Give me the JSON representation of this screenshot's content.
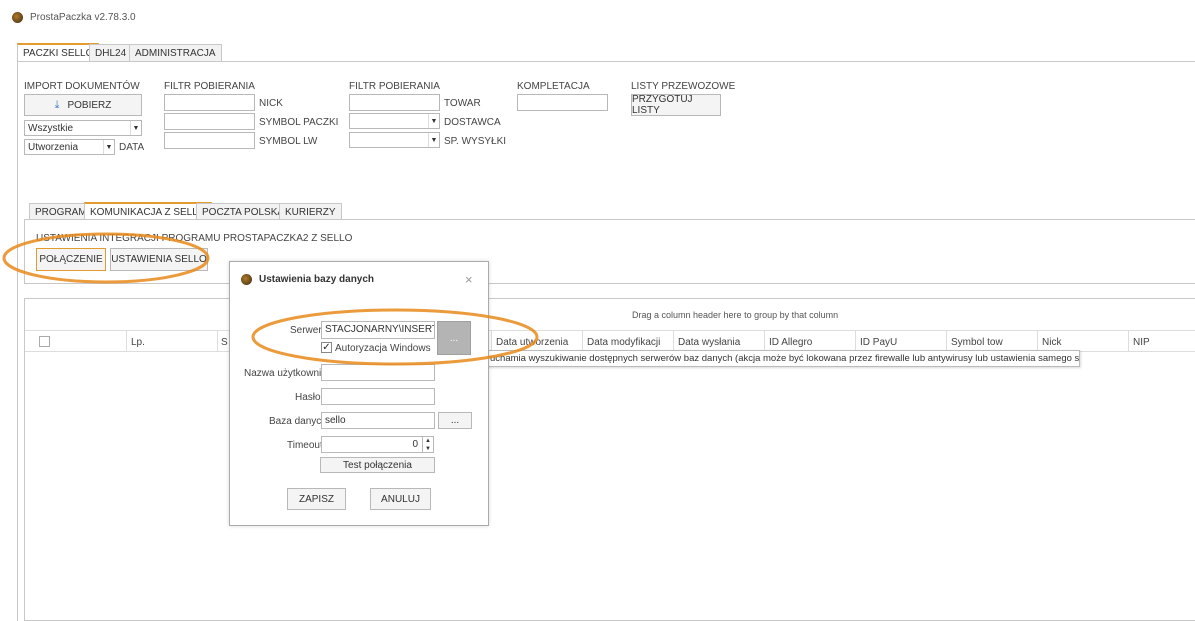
{
  "window": {
    "title": "ProstaPaczka v2.78.3.0"
  },
  "main_tabs": [
    "PACZKI SELLO",
    "DHL24",
    "ADMINISTRACJA"
  ],
  "import": {
    "heading": "IMPORT DOKUMENTÓW",
    "fetch_label": "POBIERZ",
    "filter_select": "Wszystkie",
    "date_select": "Utworzenia",
    "date_label": "DATA"
  },
  "filter1": {
    "heading": "FILTR POBIERANIA",
    "nick": "NICK",
    "symbol_paczki": "SYMBOL PACZKI",
    "symbol_lw": "SYMBOL LW"
  },
  "filter2": {
    "heading": "FILTR POBIERANIA",
    "towar": "TOWAR",
    "dostawca": "DOSTAWCA",
    "sp_wysylki": "SP. WYSYŁKI"
  },
  "kompletacja": {
    "heading": "KOMPLETACJA"
  },
  "listy": {
    "heading": "LISTY PRZEWOZOWE",
    "button": "PRZYGOTUJ LISTY"
  },
  "sub_tabs": [
    "PROGRAM",
    "KOMUNIKACJA Z SELLO",
    "POCZTA POLSKA",
    "KURIERZY"
  ],
  "integration": {
    "heading": "USTAWIENIA INTEGRACJI PROGRAMU PROSTAPACZKA2 Z SELLO",
    "connection_button": "POŁĄCZENIE",
    "settings_button": "USTAWIENIA SELLO"
  },
  "grid": {
    "group_hint": "Drag a column header here to group by that column",
    "col_lp": "Lp.",
    "col_s": "S",
    "columns": [
      "Data utworzenia",
      "Data modyfikacji",
      "Data wysłania",
      "ID Allegro",
      "ID PayU",
      "Symbol tow",
      "Nick",
      "NIP"
    ]
  },
  "dialog": {
    "title": "Ustawienia bazy danych",
    "close": "×",
    "server_label": "Serwer:",
    "server_value": "STACJONARNY\\INSERTGT",
    "browse_button": "...",
    "windows_auth": "Autoryzacja Windows",
    "username_label": "Nazwa użytkownika:",
    "password_label": "Hasło:",
    "db_label": "Baza danych:",
    "db_value": "sello",
    "db_browse": "...",
    "timeout_label": "Timeout:",
    "timeout_value": "0",
    "test_button": "Test połączenia",
    "save_button": "ZAPISZ",
    "cancel_button": "ANULUJ"
  },
  "tooltip": {
    "text": "Uruchamia wyszukiwanie dostępnych serwerów baz danych (akcja może być lokowana przez firewalle lub antywirusy lub ustawienia samego serwera"
  },
  "colors": {
    "accent": "#e39b2e",
    "highlight": "#e88a1a"
  }
}
